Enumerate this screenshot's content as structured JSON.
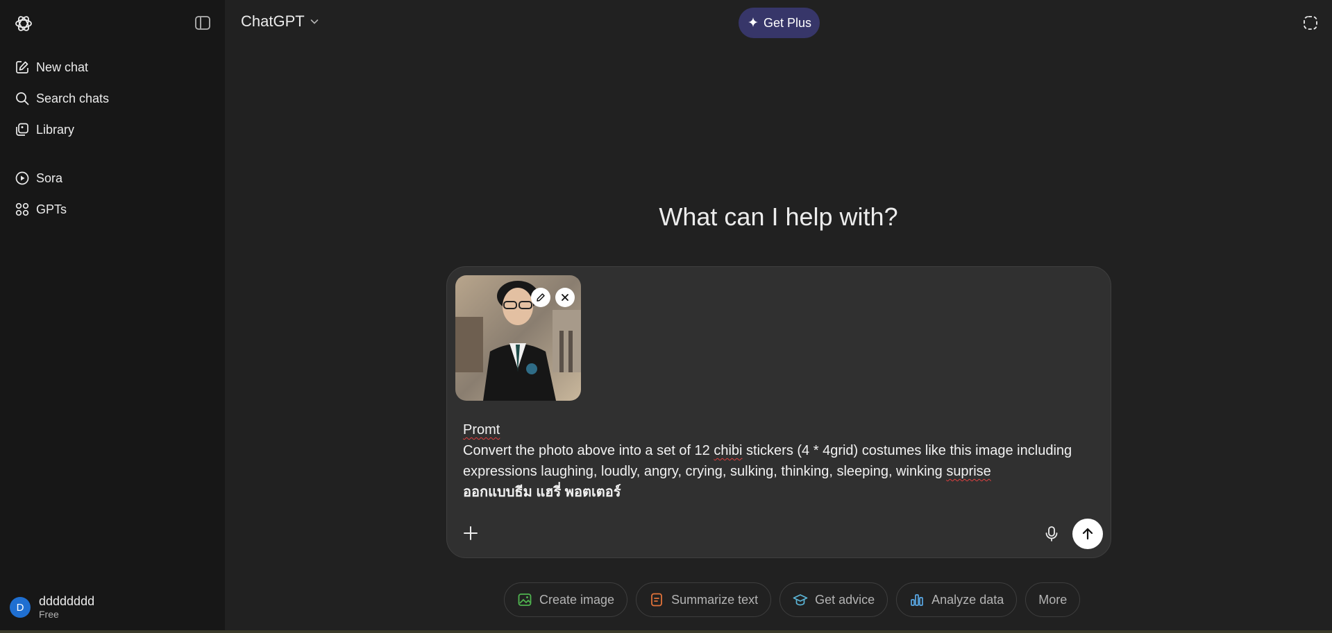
{
  "sidebar": {
    "logo_icon": "openai-logo-icon",
    "toggle_icon": "sidebar-toggle-icon",
    "items": [
      {
        "label": "New chat",
        "icon": "pencil-square-icon"
      },
      {
        "label": "Search chats",
        "icon": "search-icon"
      },
      {
        "label": "Library",
        "icon": "library-icon"
      },
      {
        "label": "Sora",
        "icon": "play-circle-icon"
      },
      {
        "label": "GPTs",
        "icon": "grid-icon"
      }
    ],
    "user": {
      "initial": "D",
      "name": "dddddddd",
      "plan": "Free"
    }
  },
  "header": {
    "title": "ChatGPT",
    "get_plus_label": "Get Plus",
    "temporary_chat_icon": "dashed-circle-icon"
  },
  "main": {
    "headline": "What can I help with?"
  },
  "composer": {
    "attachment_alt": "Attached photo",
    "prompt_lines": [
      "Promt",
      "Convert the photo above into a set of 12 chibi stickers (4 * 4grid) costumes like this image including",
      "expressions laughing, loudly, angry, crying, sulking, thinking, sleeping, winking suprise",
      "ออกแบบธีม แฮรี่ พอตเตอร์"
    ]
  },
  "chips": [
    {
      "label": "Create image",
      "icon": "image-icon",
      "color": "#4fb34f"
    },
    {
      "label": "Summarize text",
      "icon": "document-icon",
      "color": "#e2733a"
    },
    {
      "label": "Get advice",
      "icon": "graduation-cap-icon",
      "color": "#5bb5d6"
    },
    {
      "label": "Analyze data",
      "icon": "bar-chart-icon",
      "color": "#5aa9e6"
    },
    {
      "label": "More",
      "icon": "",
      "color": "#b4b4b4"
    }
  ],
  "colors": {
    "background": "#212121",
    "sidebar": "#171717",
    "composer": "#303030",
    "get_plus": "#373669",
    "avatar": "#1f6fd1"
  }
}
